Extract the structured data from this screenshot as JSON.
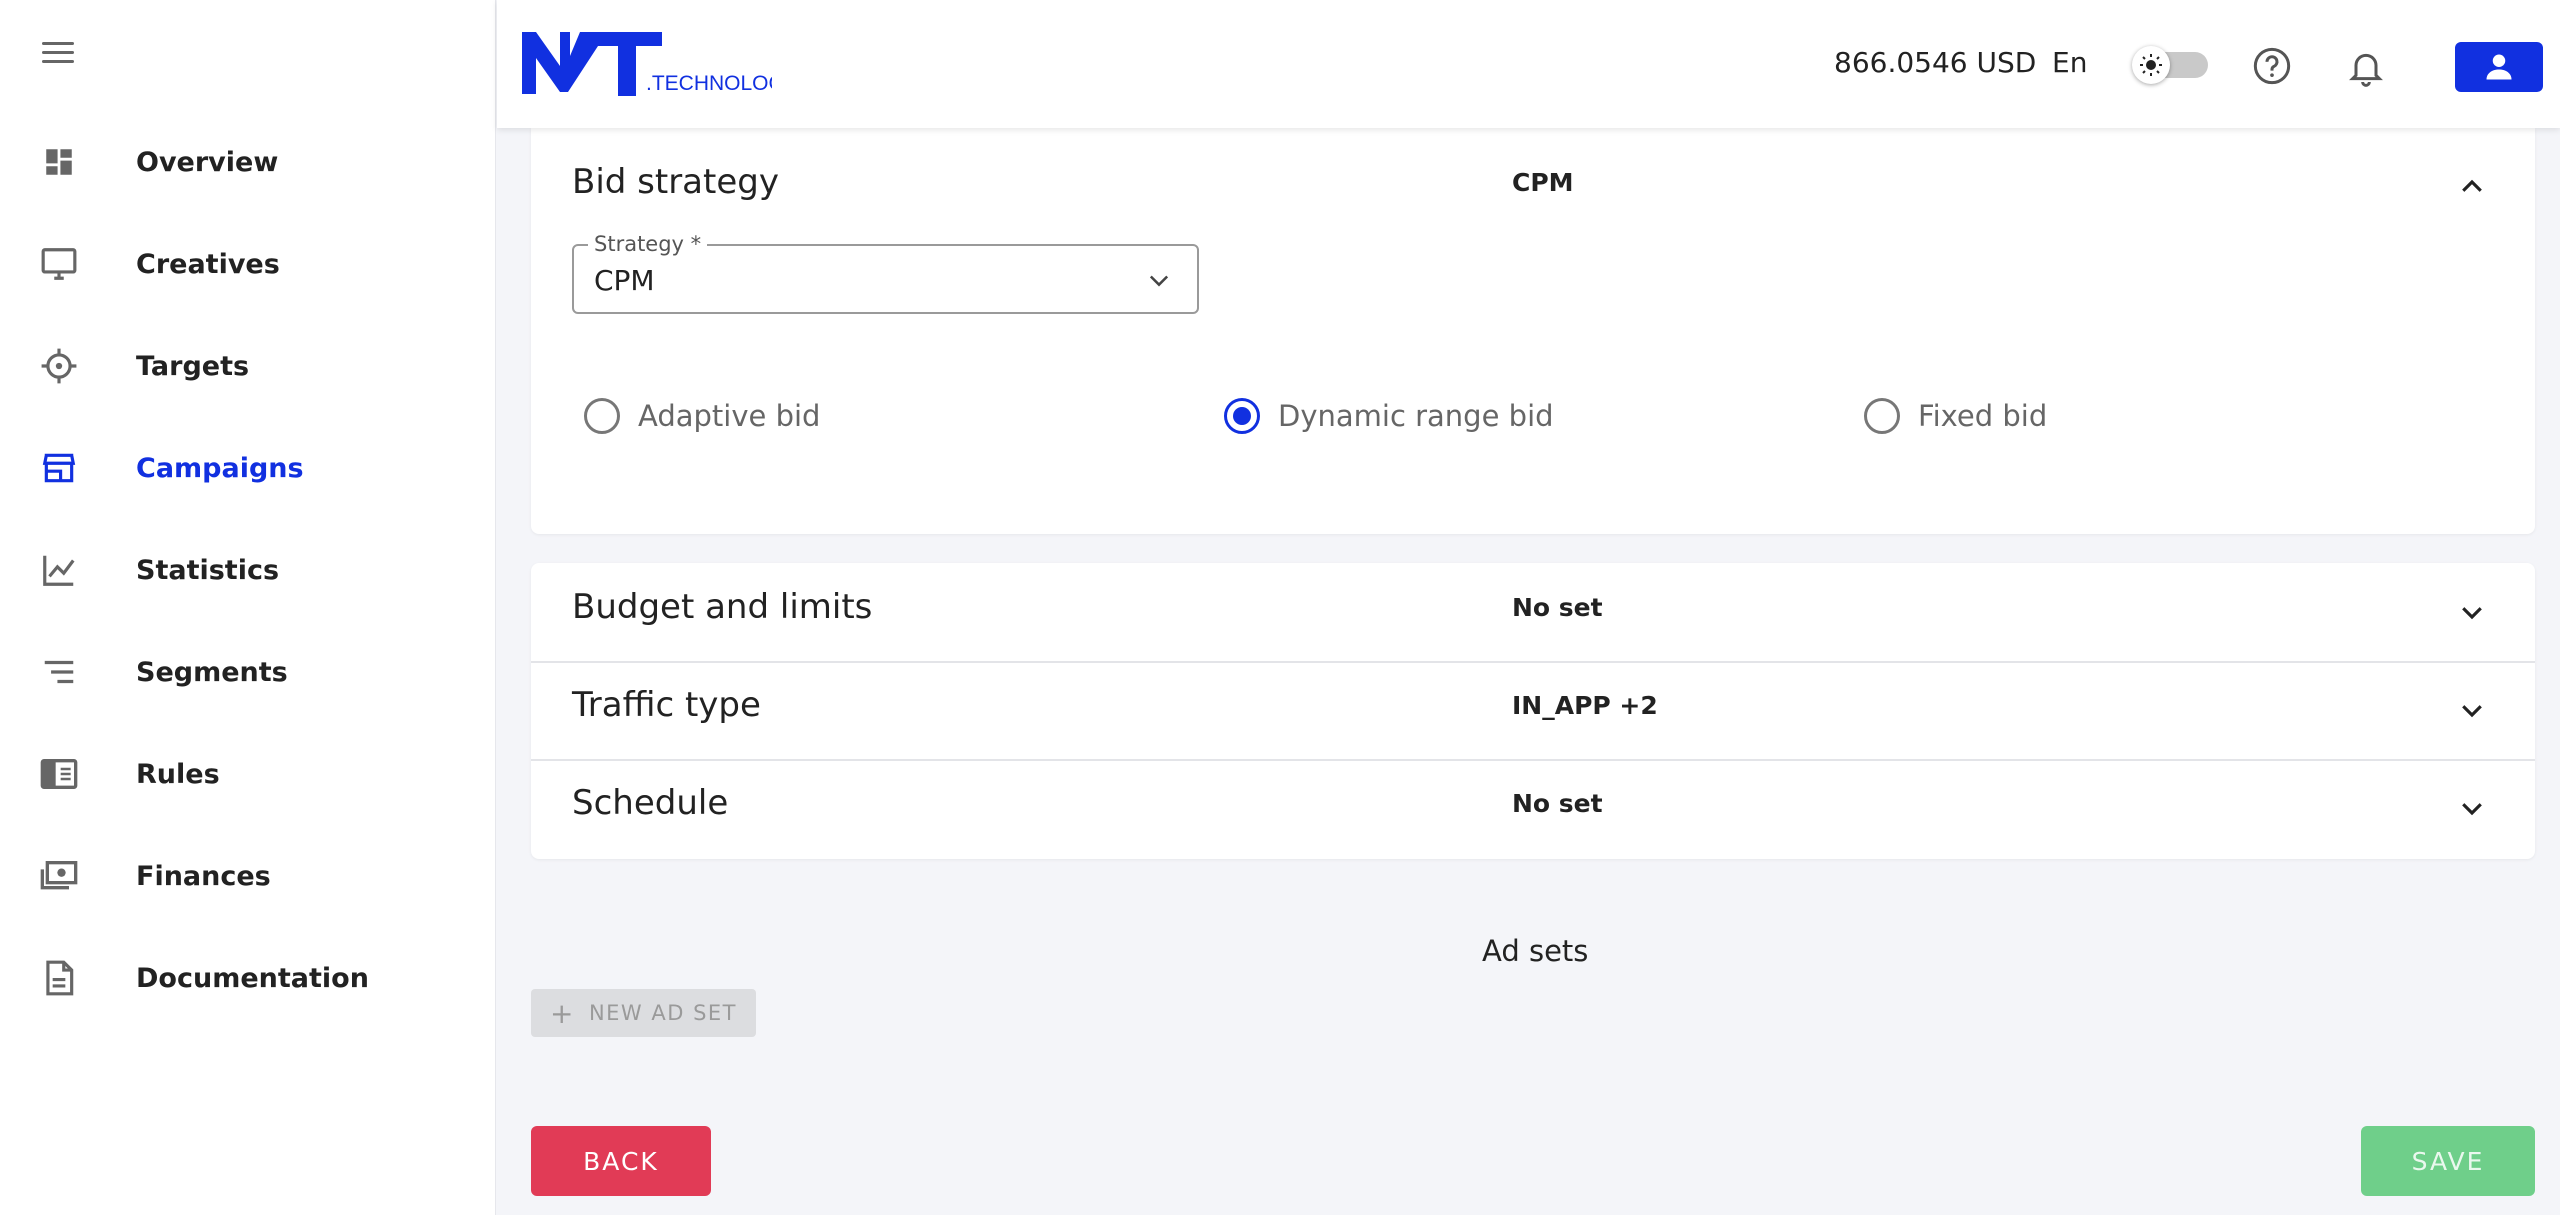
{
  "header": {
    "logo_text": "NT",
    "logo_suffix": ".TECHNOLOGY",
    "balance": "866.0546 USD",
    "language": "En",
    "icons": [
      "menu-icon",
      "theme-toggle",
      "help-icon",
      "bell-icon",
      "user-icon"
    ]
  },
  "sidebar": {
    "items": [
      {
        "label": "Overview",
        "icon": "dashboard-icon"
      },
      {
        "label": "Creatives",
        "icon": "monitor-icon"
      },
      {
        "label": "Targets",
        "icon": "crosshair-icon"
      },
      {
        "label": "Campaigns",
        "icon": "store-icon"
      },
      {
        "label": "Statistics",
        "icon": "line-chart-icon"
      },
      {
        "label": "Segments",
        "icon": "list-icon"
      },
      {
        "label": "Rules",
        "icon": "rules-icon"
      },
      {
        "label": "Finances",
        "icon": "money-icon"
      },
      {
        "label": "Documentation",
        "icon": "document-icon"
      }
    ],
    "active": "Campaigns"
  },
  "bid_strategy": {
    "title": "Bid strategy",
    "summary": "CPM",
    "field_label": "Strategy *",
    "field_value": "CPM",
    "options": [
      {
        "label": "Adaptive bid",
        "checked": false
      },
      {
        "label": "Dynamic range bid",
        "checked": true
      },
      {
        "label": "Fixed bid",
        "checked": false
      }
    ]
  },
  "sections": [
    {
      "title": "Budget and limits",
      "summary": "No set"
    },
    {
      "title": "Traffic type",
      "summary": "IN_APP +2"
    },
    {
      "title": "Schedule",
      "summary": "No set"
    }
  ],
  "ad_sets": {
    "title": "Ad sets",
    "new_button": "NEW AD SET"
  },
  "actions": {
    "back": "BACK",
    "save": "SAVE"
  },
  "colors": {
    "accent": "#1130e0",
    "danger": "#e13b56",
    "success": "#6fcf8a"
  }
}
